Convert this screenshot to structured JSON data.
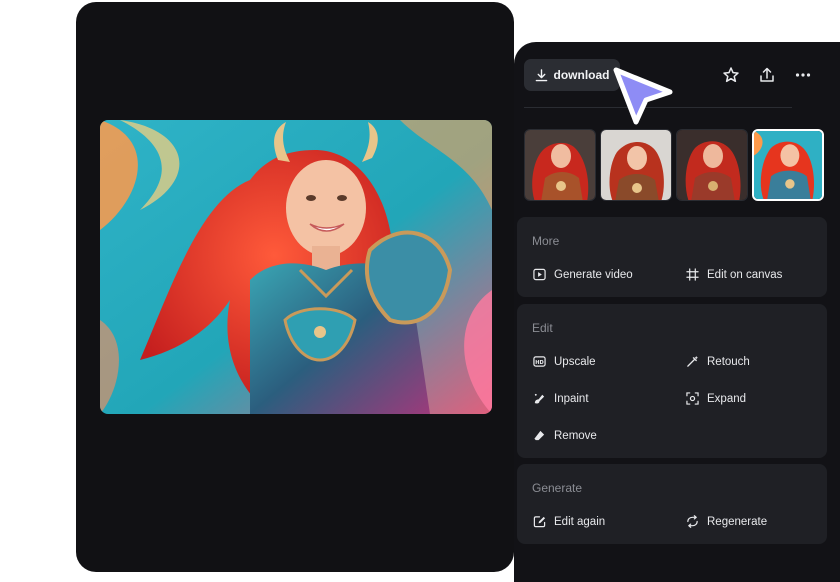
{
  "toolbar": {
    "download_label": "download",
    "icons": [
      "download-icon",
      "star-icon",
      "share-icon",
      "more-icon"
    ]
  },
  "thumbnails": {
    "count": 4,
    "selected_index": 3
  },
  "sections": {
    "more": {
      "title": "More",
      "actions": [
        "Generate video",
        "Edit on canvas"
      ]
    },
    "edit": {
      "title": "Edit",
      "actions": [
        "Upscale",
        "Retouch",
        "Inpaint",
        "Expand",
        "Remove"
      ]
    },
    "generate": {
      "title": "Generate",
      "actions": [
        "Edit again",
        "Regenerate"
      ]
    }
  },
  "colors": {
    "viewer_bg": "#111114",
    "panel_bg": "#121216",
    "card_bg": "#1f2025",
    "cursor_accent": "#8e8cf5"
  }
}
